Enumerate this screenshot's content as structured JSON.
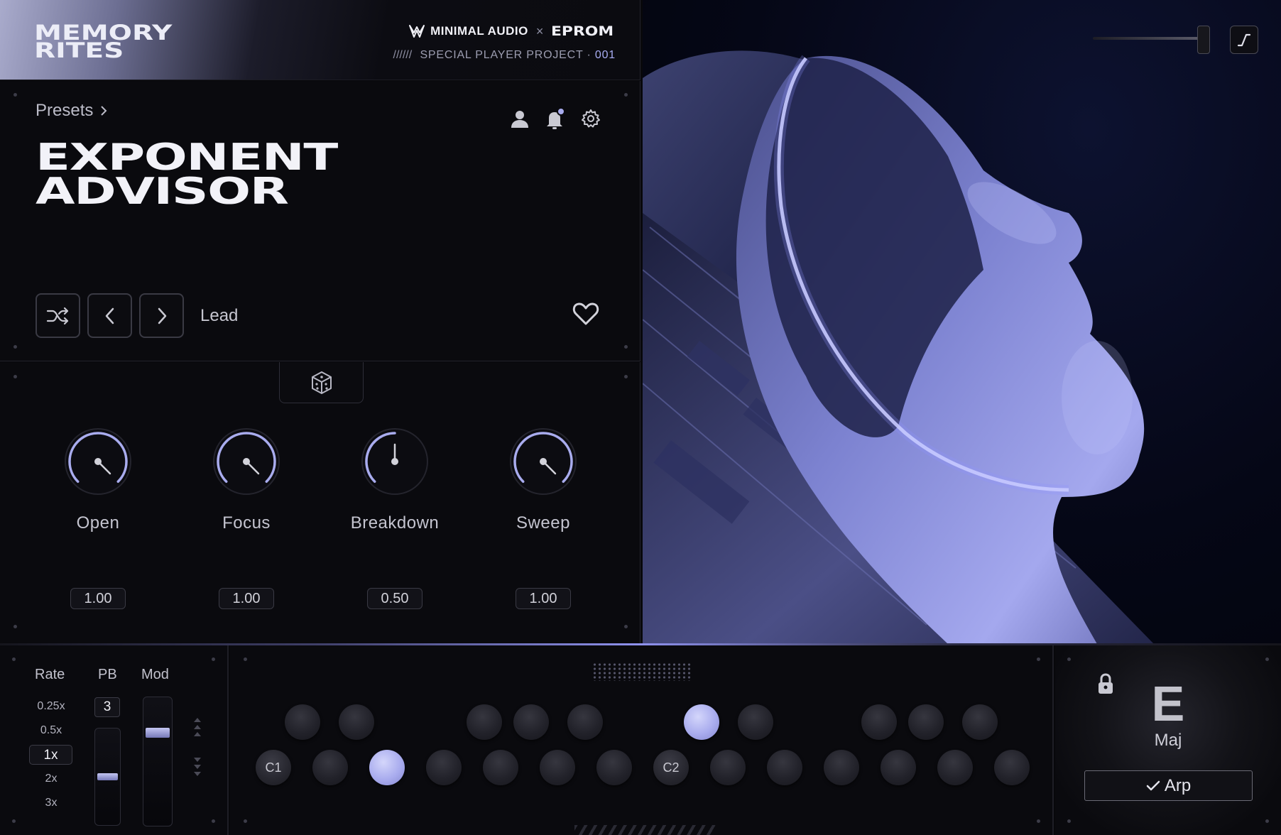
{
  "header": {
    "logo_line1": "MEMORY",
    "logo_line2": "RITES",
    "brand_left": "MINIMAL AUDIO",
    "brand_sep": "×",
    "brand_right": "EPROM",
    "subline_prefix": "//////",
    "subline_text": "SPECIAL PLAYER PROJECT ·",
    "subline_number": "001"
  },
  "preset": {
    "presets_label": "Presets",
    "name_line1": "EXPONENT",
    "name_line2": "ADVISOR",
    "category": "Lead",
    "favorite": false
  },
  "macros": [
    {
      "label": "Open",
      "value": "1.00",
      "level": 1.0
    },
    {
      "label": "Focus",
      "value": "1.00",
      "level": 1.0
    },
    {
      "label": "Breakdown",
      "value": "0.50",
      "level": 0.5
    },
    {
      "label": "Sweep",
      "value": "1.00",
      "level": 1.0
    }
  ],
  "performance": {
    "rate_header": "Rate",
    "pb_header": "PB",
    "mod_header": "Mod",
    "rates": [
      "0.25x",
      "0.5x",
      "1x",
      "2x",
      "3x"
    ],
    "selected_rate": "1x",
    "pb_range": "3",
    "pitch_bend_level": 0.5,
    "mod_level": 0.75
  },
  "keyboard": {
    "label_c1": "C1",
    "label_c2": "C2",
    "active_keys": [
      "D1",
      "D#2"
    ]
  },
  "chord": {
    "root": "E",
    "quality": "Maj",
    "arp_label": "Arp",
    "arp_checked": true
  },
  "colors": {
    "accent": "#a9acee",
    "background": "#0a0a0e",
    "text": "#c4c4cf"
  },
  "icons": {
    "shuffle": "shuffle-icon",
    "prev": "chevron-left-icon",
    "next": "chevron-right-icon",
    "favorite": "heart-icon",
    "user": "user-icon",
    "bell": "bell-icon",
    "settings": "gear-icon",
    "randomize": "dice-icon",
    "lock": "lock-icon",
    "envelope": "envelope-icon"
  },
  "artwork_slider_level": 0.85
}
